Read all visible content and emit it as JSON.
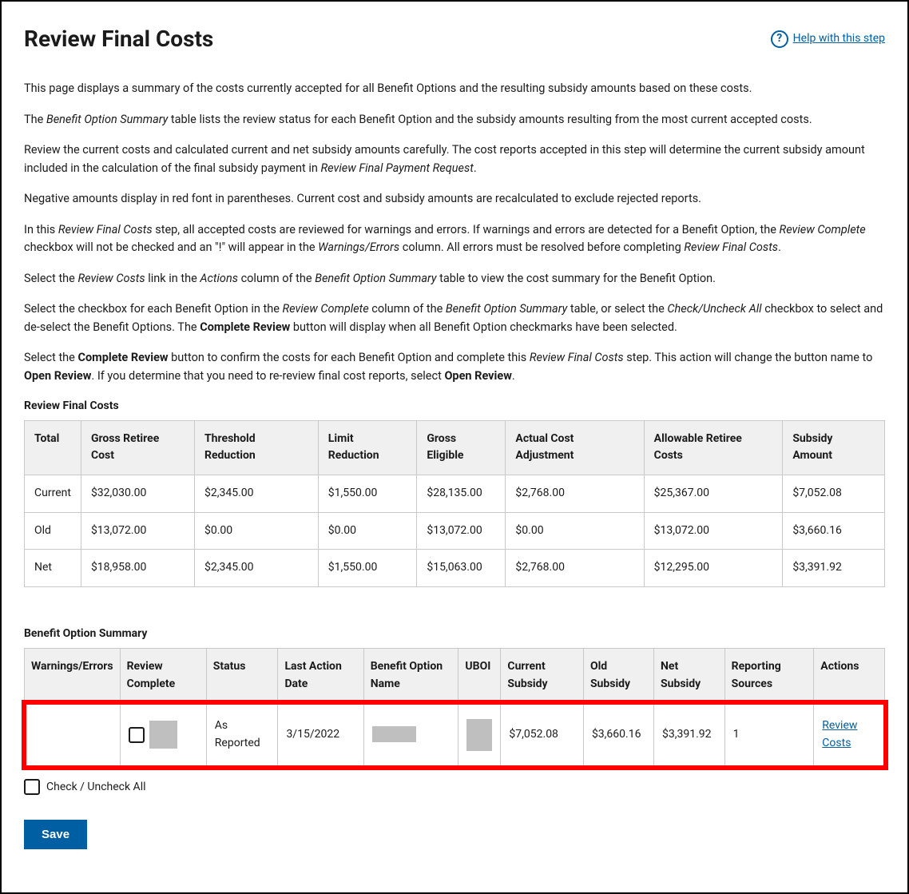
{
  "header": {
    "title": "Review Final Costs",
    "help_label": "Help with this step"
  },
  "intro": {
    "p1": "This page displays a summary of the costs currently accepted for all Benefit Options and the resulting subsidy amounts based on these costs.",
    "p2_a": "The ",
    "p2_em": "Benefit Option Summary",
    "p2_b": " table lists the review status for each Benefit Option and the subsidy amounts resulting from the most current accepted costs.",
    "p3_a": "Review the current costs and calculated current and net subsidy amounts carefully. The cost reports accepted in this step will determine the current subsidy amount included in the calculation of the final subsidy payment in ",
    "p3_em": "Review Final Payment Request",
    "p3_b": ".",
    "p4": "Negative amounts display in red font in parentheses. Current cost and subsidy amounts are recalculated to exclude rejected reports.",
    "p5_a": "In this ",
    "p5_em1": "Review Final Costs",
    "p5_b": " step, all accepted costs are reviewed for warnings and errors. If warnings and errors are detected for a Benefit Option, the ",
    "p5_em2": "Review Complete",
    "p5_c": " checkbox will not be checked and an \"!\" will appear in the ",
    "p5_em3": "Warnings/Errors",
    "p5_d": " column. All errors must be resolved before completing ",
    "p5_em4": "Review Final Costs",
    "p5_e": ".",
    "p6_a": "Select the ",
    "p6_em1": "Review Costs",
    "p6_b": " link in the ",
    "p6_em2": "Actions",
    "p6_c": " column of the ",
    "p6_em3": "Benefit Option Summary",
    "p6_d": " table to view the cost summary for the Benefit Option.",
    "p7_a": "Select the checkbox for each Benefit Option in the ",
    "p7_em1": "Review Complete",
    "p7_b": " column of the ",
    "p7_em2": "Benefit Option Summary",
    "p7_c": " table, or select the ",
    "p7_em3": "Check/Uncheck All",
    "p7_d": " checkbox to select and de-select the Benefit Options. The ",
    "p7_strong": "Complete Review",
    "p7_e": " button will display when all Benefit Option checkmarks have been selected.",
    "p8_a": "Select the ",
    "p8_strong1": "Complete Review",
    "p8_b": " button to confirm the costs for each Benefit Option and complete this ",
    "p8_em": "Review Final Costs",
    "p8_c": " step. This action will change the button name to ",
    "p8_strong2": "Open Review",
    "p8_d": ". If you determine that you need to re-review final cost reports, select ",
    "p8_strong3": "Open Review",
    "p8_e": "."
  },
  "costs_label": "Review Final Costs",
  "costs_headers": {
    "total": "Total",
    "gross_retiree": "Gross Retiree Cost",
    "threshold": "Threshold Reduction",
    "limit": "Limit Reduction",
    "gross_eligible": "Gross Eligible",
    "actual_cost": "Actual Cost Adjustment",
    "allowable": "Allowable Retiree Costs",
    "subsidy": "Subsidy Amount"
  },
  "costs_rows": [
    {
      "label": "Current",
      "gross": "$32,030.00",
      "threshold": "$2,345.00",
      "limit": "$1,550.00",
      "eligible": "$28,135.00",
      "adjust": "$2,768.00",
      "allowable": "$25,367.00",
      "subsidy": "$7,052.08"
    },
    {
      "label": "Old",
      "gross": "$13,072.00",
      "threshold": "$0.00",
      "limit": "$0.00",
      "eligible": "$13,072.00",
      "adjust": "$0.00",
      "allowable": "$13,072.00",
      "subsidy": "$3,660.16"
    },
    {
      "label": "Net",
      "gross": "$18,958.00",
      "threshold": "$2,345.00",
      "limit": "$1,550.00",
      "eligible": "$15,063.00",
      "adjust": "$2,768.00",
      "allowable": "$12,295.00",
      "subsidy": "$3,391.92"
    }
  ],
  "summary_label": "Benefit Option Summary",
  "summary_headers": {
    "warnings": "Warnings/Errors",
    "review_complete": "Review Complete",
    "status": "Status",
    "last_action": "Last Action Date",
    "benefit_name": "Benefit Option Name",
    "uboi": "UBOI",
    "current_sub": "Current Subsidy",
    "old_sub": "Old Subsidy",
    "net_sub": "Net Subsidy",
    "reporting": "Reporting Sources",
    "actions": "Actions"
  },
  "summary_row": {
    "status": "As Reported",
    "last_action": "3/15/2022",
    "current_sub": "$7,052.08",
    "old_sub": "$3,660.16",
    "net_sub": "$3,391.92",
    "reporting": "1",
    "action_link": "Review Costs"
  },
  "check_all_label": "Check / Uncheck All",
  "save_label": "Save"
}
